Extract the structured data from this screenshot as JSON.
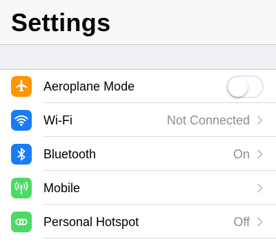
{
  "header": {
    "title": "Settings"
  },
  "rows": [
    {
      "label": "Aeroplane Mode",
      "value": "",
      "icon": "airplane-icon",
      "icon_color": "#ff9500",
      "control": "toggle",
      "toggle_on": false
    },
    {
      "label": "Wi-Fi",
      "value": "Not Connected",
      "icon": "wifi-icon",
      "icon_color": "#1a7cf5",
      "control": "chevron",
      "highlighted": true
    },
    {
      "label": "Bluetooth",
      "value": "On",
      "icon": "bluetooth-icon",
      "icon_color": "#1a7cf5",
      "control": "chevron"
    },
    {
      "label": "Mobile",
      "value": "",
      "icon": "antenna-icon",
      "icon_color": "#4cd964",
      "control": "chevron"
    },
    {
      "label": "Personal Hotspot",
      "value": "Off",
      "icon": "hotspot-icon",
      "icon_color": "#4cd964",
      "control": "chevron"
    }
  ],
  "colors": {
    "highlight": "#f2f73b",
    "secondary_text": "#8e8e93",
    "background": "#efeff4"
  }
}
